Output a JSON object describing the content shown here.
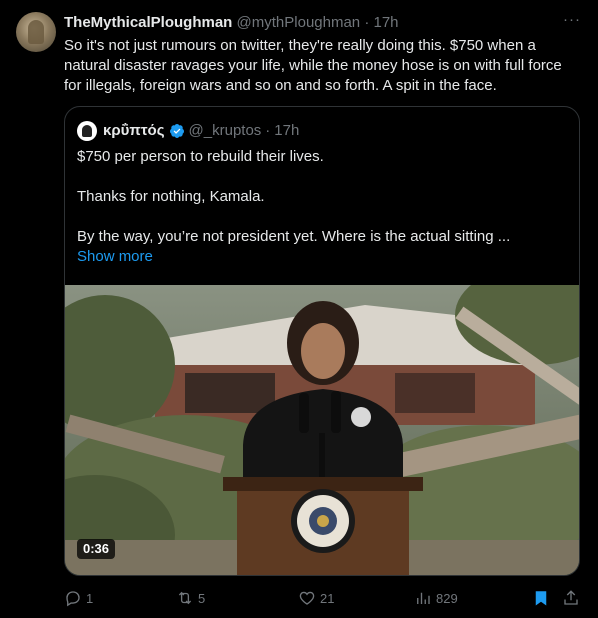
{
  "author": {
    "display_name": "TheMythicalPloughman",
    "handle": "@mythPloughman",
    "separator": "·",
    "time": "17h"
  },
  "more_glyph": "···",
  "body": "So it's not just rumours on twitter, they're really doing this. $750 when a natural disaster ravages your life, while the money hose is on with full force for illegals, foreign wars and so on and so forth. A spit in the face.",
  "quote": {
    "display_name": "κρΰπτός",
    "handle": "@_kruptos",
    "separator": "·",
    "time": "17h",
    "line1": "$750 per person to rebuild their lives.",
    "line2": "Thanks for nothing, Kamala.",
    "line3": "By the way, you’re not president yet.  Where is the actual sitting ...",
    "show_more": "Show more",
    "video": {
      "duration": "0:36"
    }
  },
  "actions": {
    "replies": "1",
    "reposts": "5",
    "likes": "21",
    "views": "829"
  },
  "colors": {
    "accent": "#1d9bf0",
    "muted": "#71767b",
    "text": "#e7e9ea",
    "border": "#2f3336"
  }
}
